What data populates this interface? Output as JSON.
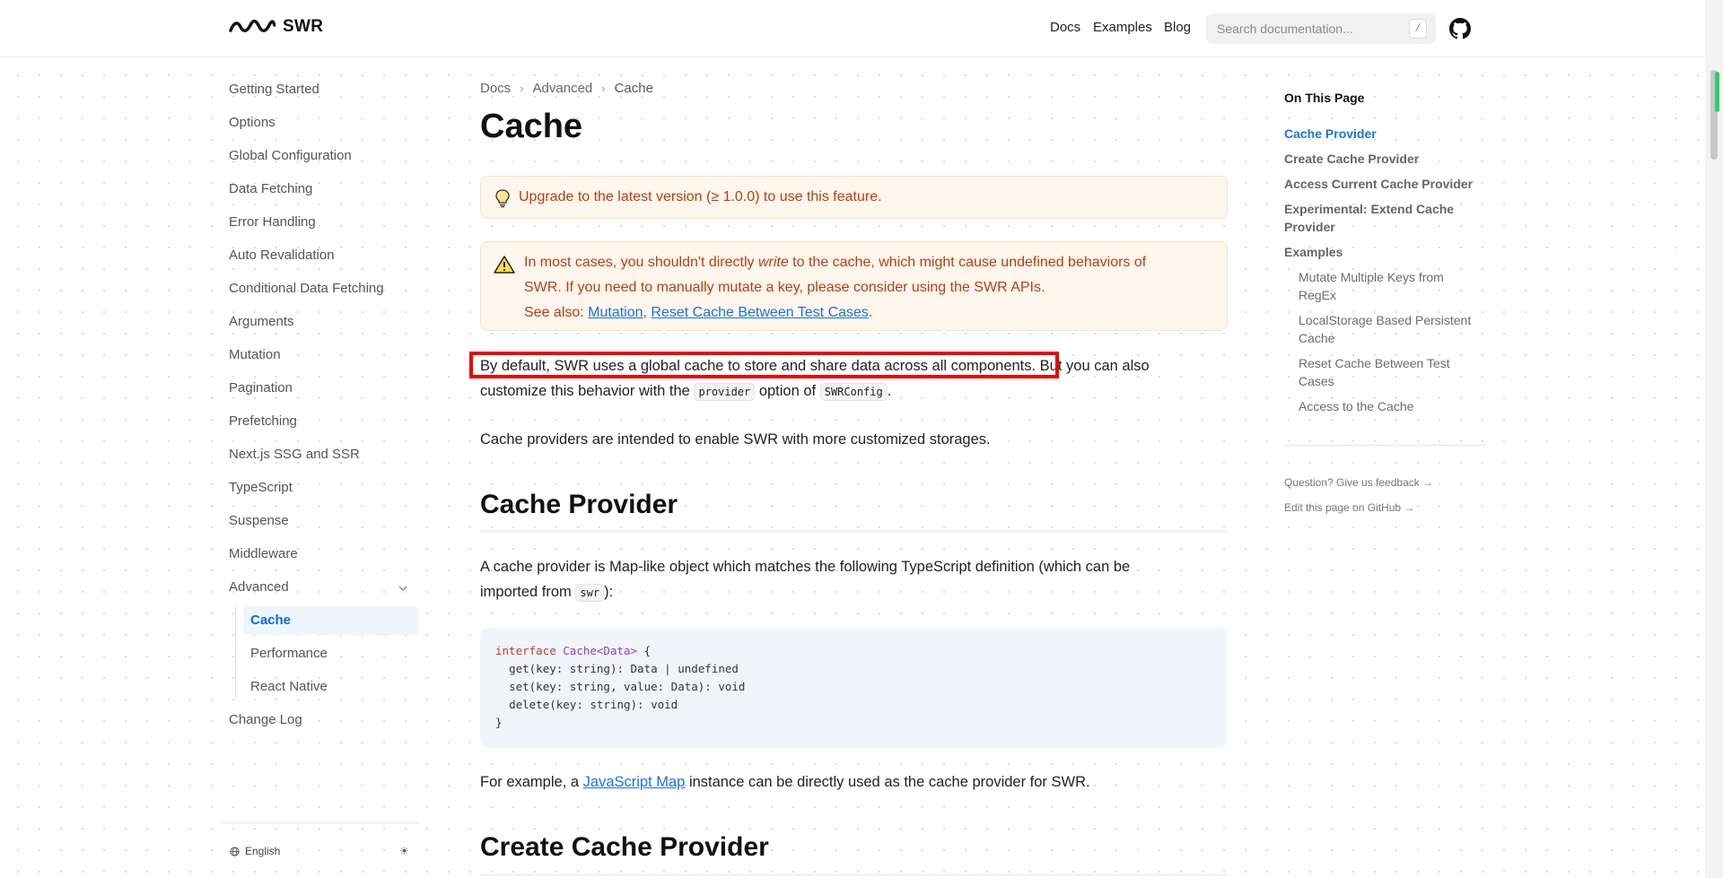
{
  "header": {
    "logo_text": "SWR",
    "nav": [
      "Docs",
      "Examples",
      "Blog"
    ],
    "search_placeholder": "Search documentation...",
    "search_shortcut": "/"
  },
  "sidebar": {
    "items": [
      "Getting Started",
      "Options",
      "Global Configuration",
      "Data Fetching",
      "Error Handling",
      "Auto Revalidation",
      "Conditional Data Fetching",
      "Arguments",
      "Mutation",
      "Pagination",
      "Prefetching",
      "Next.js SSG and SSR",
      "TypeScript",
      "Suspense",
      "Middleware",
      "Advanced"
    ],
    "sub_items": [
      "Cache",
      "Performance",
      "React Native"
    ],
    "last_item": "Change Log",
    "language": "English",
    "theme_icon": "sun-icon"
  },
  "breadcrumb": [
    "Docs",
    "Advanced",
    "Cache"
  ],
  "page_title": "Cache",
  "callout_info": "Upgrade to the latest version (≥ 1.0.0) to use this feature.",
  "callout_warning": {
    "line1_a": "In most cases, you shouldn't directly ",
    "line1_em": "write",
    "line1_b": " to the cache, which might cause undefined behaviors of",
    "line2": "SWR. If you need to manually mutate a key, please consider using the SWR APIs.",
    "see_also": "See also: ",
    "link1": "Mutation",
    "comma": ", ",
    "link2": "Reset Cache Between Test Cases",
    "period": "."
  },
  "para1": {
    "line1": "By default, SWR uses a global cache to store and share data across all components. But you can also",
    "line2_a": "customize this behavior with the ",
    "code1": "provider",
    "line2_b": " option of ",
    "code2": "SWRConfig",
    "line2_c": "."
  },
  "para2": "Cache providers are intended to enable SWR with more customized storages.",
  "h2_cache_provider": "Cache Provider",
  "para3": {
    "line1": "A cache provider is Map-like object which matches the following TypeScript definition (which can be",
    "line2_a": "imported from ",
    "code": "swr",
    "line2_b": "):"
  },
  "code_block": {
    "l1_kw": "interface",
    "l1_name": "Cache<Data>",
    "l1_rest": " {",
    "l2": "get(key: string): Data | undefined",
    "l3": "set(key: string, value: Data): void",
    "l4": "delete(key: string): void",
    "l5": "}"
  },
  "para4": {
    "a": "For example, a ",
    "link": "JavaScript Map",
    "b": " instance can be directly used as the cache provider for SWR."
  },
  "h2_create": "Create Cache Provider",
  "toc": {
    "title": "On This Page",
    "items": [
      "Cache Provider",
      "Create Cache Provider",
      "Access Current Cache Provider",
      "Experimental: Extend Cache Provider",
      "Examples"
    ],
    "sub_items": [
      "Mutate Multiple Keys from RegEx",
      "LocalStorage Based Persistent Cache",
      "Reset Cache Between Test Cases",
      "Access to the Cache"
    ],
    "feedback": "Question? Give us feedback →",
    "edit": "Edit this page on GitHub →"
  },
  "colors": {
    "accent": "#1b73d9",
    "warning_text": "#b4400e",
    "warning_bg": "#fff6ee",
    "highlight": "#ee0000"
  }
}
